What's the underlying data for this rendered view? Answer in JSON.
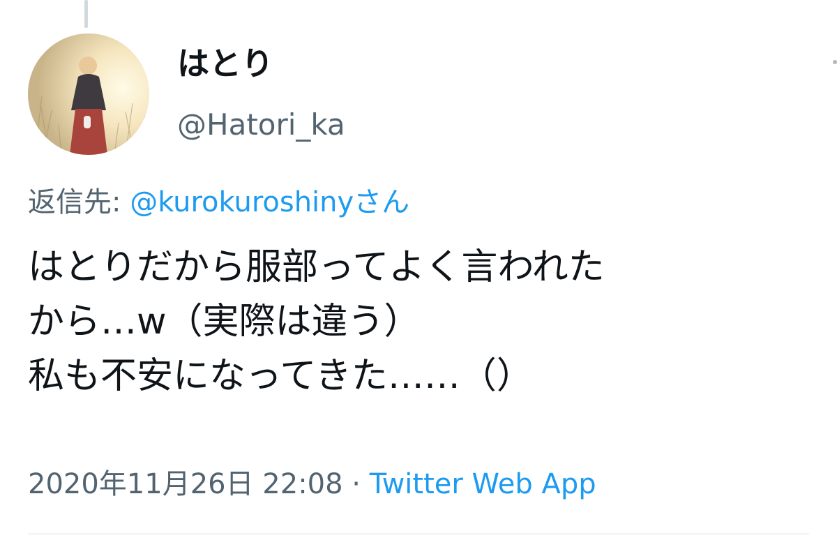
{
  "tweet": {
    "avatar_icon": "profile-photo-icon",
    "display_name": "はとり",
    "handle": "@Hatori_ka",
    "reply_prefix": "返信先: ",
    "reply_mention": "@kurokuroshinyさん",
    "body_lines": [
      "はとりだから服部ってよく言われた",
      "から…w（実際は違う）",
      "私も不安になってきた……（）"
    ],
    "timestamp": "2020年11月26日 22:08",
    "separator": " · ",
    "source": "Twitter Web App"
  },
  "colors": {
    "text_primary": "#0f1419",
    "text_secondary": "#536471",
    "link": "#1d9bf0",
    "thread_line": "#cfd9de"
  }
}
